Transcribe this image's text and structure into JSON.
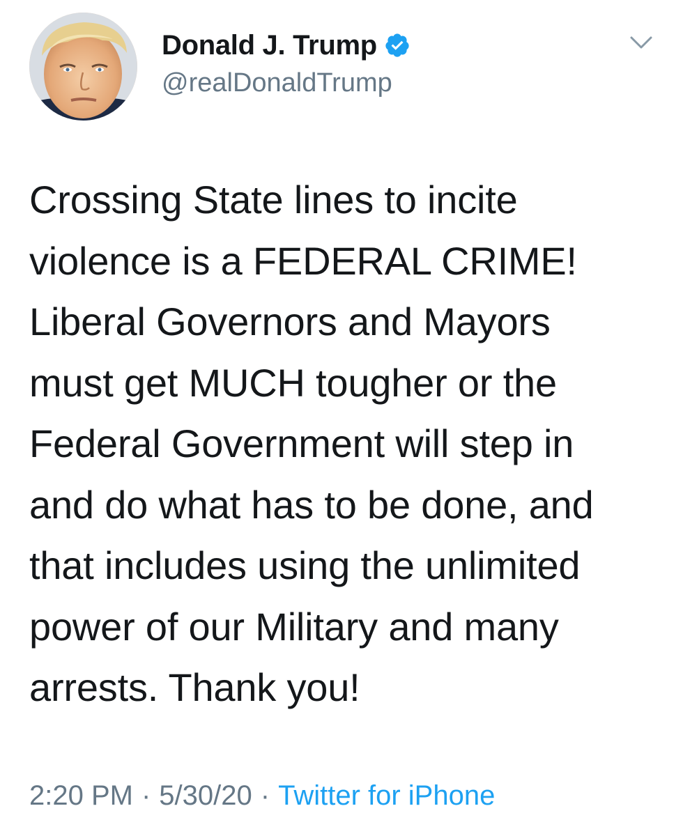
{
  "user": {
    "display_name": "Donald J. Trump",
    "handle": "@realDonaldTrump",
    "verified_icon": "verified-badge-icon",
    "verified_color": "#1da1f2"
  },
  "tweet": {
    "lines": [
      "Crossing State lines to incite",
      "violence is a FEDERAL CRIME!",
      "Liberal Governors and Mayors",
      "must get MUCH tougher or the",
      "Federal Government will step in",
      "and do what has to be done, and",
      "that includes using the unlimited",
      "power of our Military and many",
      "arrests. Thank you!"
    ]
  },
  "meta": {
    "time": "2:20 PM",
    "separator": "·",
    "date": "5/30/20",
    "source": "Twitter for iPhone",
    "source_color": "#1da1f2"
  },
  "menu_icon": "chevron-down-icon"
}
